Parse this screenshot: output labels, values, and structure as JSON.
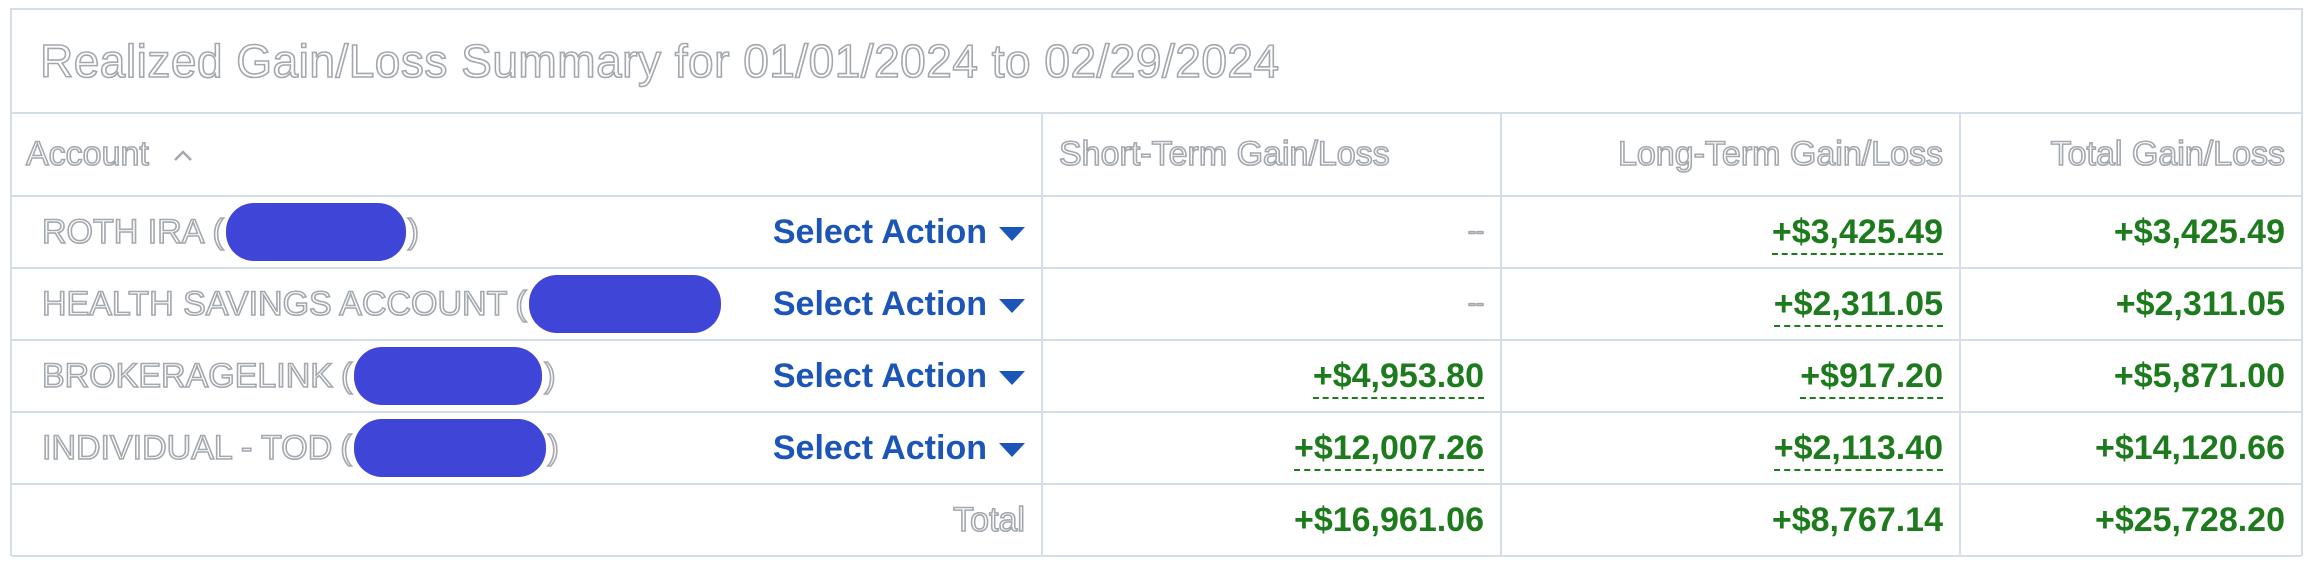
{
  "title": "Realized Gain/Loss Summary for 01/01/2024 to 02/29/2024",
  "headers": {
    "account": "Account",
    "sort_icon": "chevron-up-icon",
    "short_term": "Short-Term Gain/Loss",
    "long_term": "Long-Term Gain/Loss",
    "total": "Total Gain/Loss"
  },
  "rows": [
    {
      "account": "ROTH IRA",
      "open_paren": "(",
      "close_paren": ")",
      "action_label": "Select Action",
      "short_term": "--",
      "long_term": "+$3,425.49",
      "total": "+$3,425.49"
    },
    {
      "account": "HEALTH SAVINGS ACCOUNT",
      "open_paren": "(",
      "close_paren": "",
      "action_label": "Select Action",
      "short_term": "--",
      "long_term": "+$2,311.05",
      "total": "+$2,311.05"
    },
    {
      "account": "BROKERAGELINK",
      "open_paren": "(",
      "close_paren": ")",
      "action_label": "Select Action",
      "short_term": "+$4,953.80",
      "long_term": "+$917.20",
      "total": "+$5,871.00"
    },
    {
      "account": "INDIVIDUAL - TOD",
      "open_paren": "(",
      "close_paren": ")",
      "action_label": "Select Action",
      "short_term": "+$12,007.26",
      "long_term": "+$2,113.40",
      "total": "+$14,120.66"
    }
  ],
  "totals": {
    "label": "Total",
    "short_term": "+$16,961.06",
    "long_term": "+$8,767.14",
    "total": "+$25,728.20"
  },
  "colors": {
    "gain": "#1d7a1d",
    "action": "#1b55b7",
    "redaction": "#3f45d6",
    "border": "#d5dde6"
  }
}
